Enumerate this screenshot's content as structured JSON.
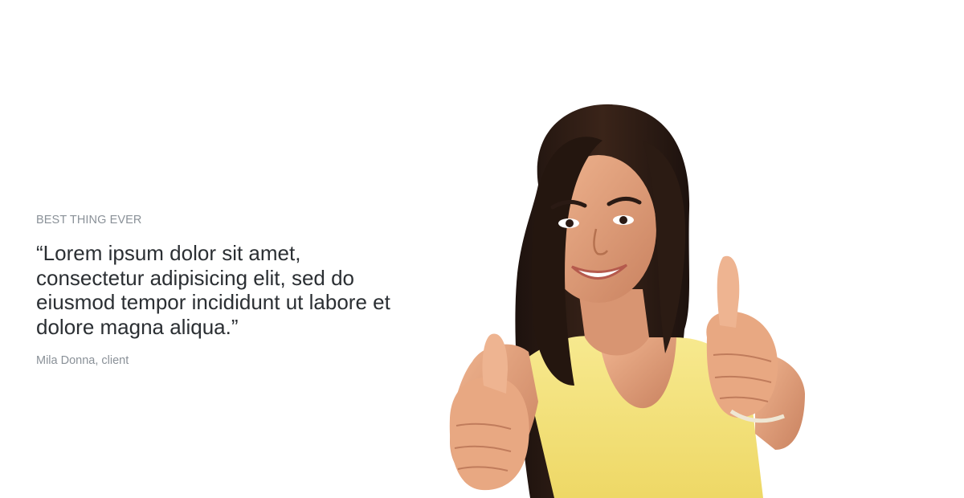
{
  "testimonial": {
    "eyebrow": "BEST THING EVER",
    "quote": "“Lorem ipsum dolor sit amet, consectetur adipisicing elit, sed do eiusmod tempor incididunt ut labore et dolore magna aliqua.”",
    "author": "Mila Donna, client"
  },
  "photo": {
    "subject": "smiling woman giving two thumbs up"
  },
  "colors": {
    "background": "#ffffff",
    "heading": "#2b2f33",
    "muted": "#8a9198",
    "shirt": "#f4e27e",
    "hair": "#2a1a14",
    "skin": "#e0a07d"
  }
}
